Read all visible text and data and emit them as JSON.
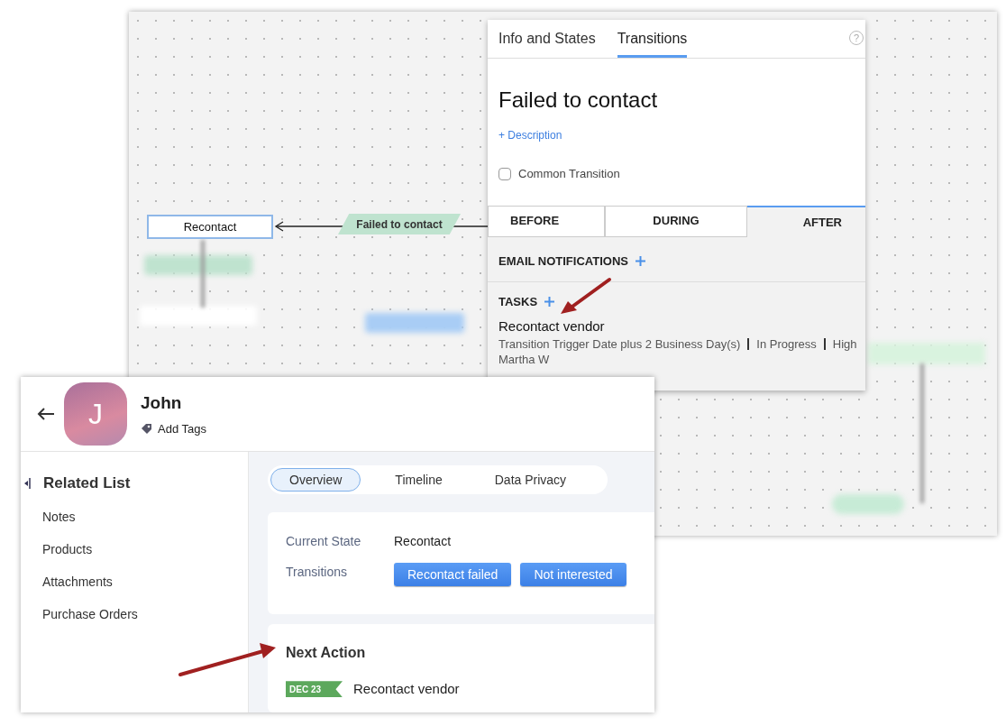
{
  "diagram": {
    "state_node": "Recontact",
    "transition_label": "Failed to contact"
  },
  "panel": {
    "tabs": [
      {
        "label": "Info and States",
        "selected": false
      },
      {
        "label": "Transitions",
        "selected": true
      }
    ],
    "help": "?",
    "title": "Failed to contact",
    "description_link": "+ Description",
    "common_transition": {
      "label": "Common Transition",
      "checked": false
    },
    "phase_tabs": [
      {
        "label": "BEFORE",
        "selected": false
      },
      {
        "label": "DURING",
        "selected": false
      },
      {
        "label": "AFTER",
        "selected": true
      }
    ],
    "email_notifications": {
      "label": "EMAIL NOTIFICATIONS"
    },
    "tasks": {
      "label": "TASKS",
      "items": [
        {
          "title": "Recontact vendor",
          "details": [
            "Transition Trigger Date plus 2 Business Day(s)",
            "In Progress",
            "High"
          ],
          "owner": "Martha W"
        }
      ]
    }
  },
  "record": {
    "avatar_initial": "J",
    "name": "John",
    "add_tags": "Add Tags",
    "related_list": {
      "title": "Related List",
      "items": [
        "Notes",
        "Products",
        "Attachments",
        "Purchase Orders"
      ]
    },
    "view_tabs": [
      {
        "label": "Overview",
        "selected": true
      },
      {
        "label": "Timeline",
        "selected": false
      },
      {
        "label": "Data Privacy",
        "selected": false
      }
    ],
    "current_state": {
      "label": "Current State",
      "value": "Recontact"
    },
    "transitions": {
      "label": "Transitions",
      "buttons": [
        "Recontact failed",
        "Not interested"
      ]
    },
    "next_action": {
      "title": "Next Action",
      "date": "DEC 23",
      "task": "Recontact vendor"
    }
  }
}
